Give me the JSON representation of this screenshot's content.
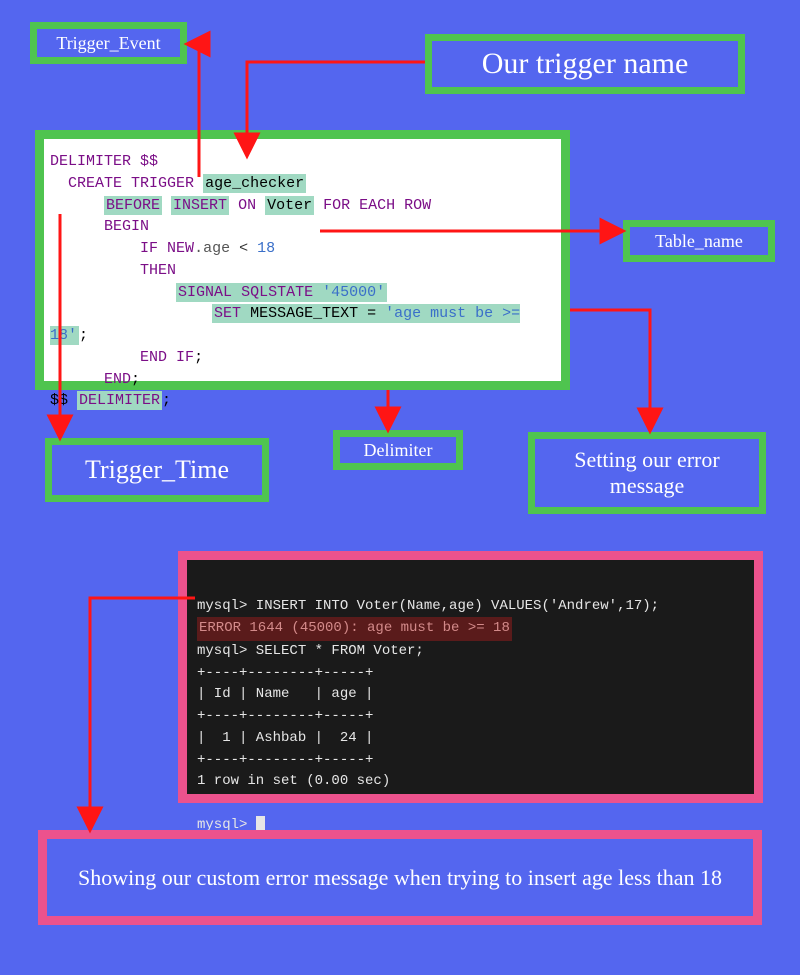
{
  "labels": {
    "trigger_event": "Trigger_Event",
    "trigger_name": "Our trigger name",
    "table_name": "Table_name",
    "trigger_time": "Trigger_Time",
    "delimiter": "Delimiter",
    "error_setting": "Setting our error message",
    "caption": "Showing our custom error message when trying to insert age less than 18"
  },
  "code": {
    "l1a": "DELIMITER $$",
    "l2a": "CREATE TRIGGER",
    "l2b": "age_checker",
    "l3a": "BEFORE",
    "l3b": "INSERT",
    "l3c": "ON",
    "l3d": "Voter",
    "l3e": "FOR EACH ROW",
    "l4": "BEGIN",
    "l5a": "IF",
    "l5b": "NEW",
    "l5c": ".age",
    "l5d": "<",
    "l5e": "18",
    "l6": "THEN",
    "l7a": "SIGNAL",
    "l7b": "SQLSTATE",
    "l7c": "'45000'",
    "l8a": "SET",
    "l8b": "MESSAGE_TEXT",
    "l8c": "=",
    "l8d": "'age must be >= 18'",
    "l8e": ";",
    "l9a": "END",
    "l9b": "IF",
    "l9c": ";",
    "l10a": "END",
    "l10b": ";",
    "l11a": "$$",
    "l11b": "DELIMITER",
    "l11c": ";"
  },
  "terminal": {
    "l1": "mysql> INSERT INTO Voter(Name,age) VALUES('Andrew',17);",
    "l2": "ERROR 1644 (45000): age must be >= 18",
    "l3": "mysql> SELECT * FROM Voter;",
    "l4": "+----+--------+-----+",
    "l5": "| Id | Name   | age |",
    "l6": "+----+--------+-----+",
    "l7": "|  1 | Ashbab |  24 |",
    "l8": "+----+--------+-----+",
    "l9": "1 row in set (0.00 sec)",
    "l10": "mysql> "
  }
}
